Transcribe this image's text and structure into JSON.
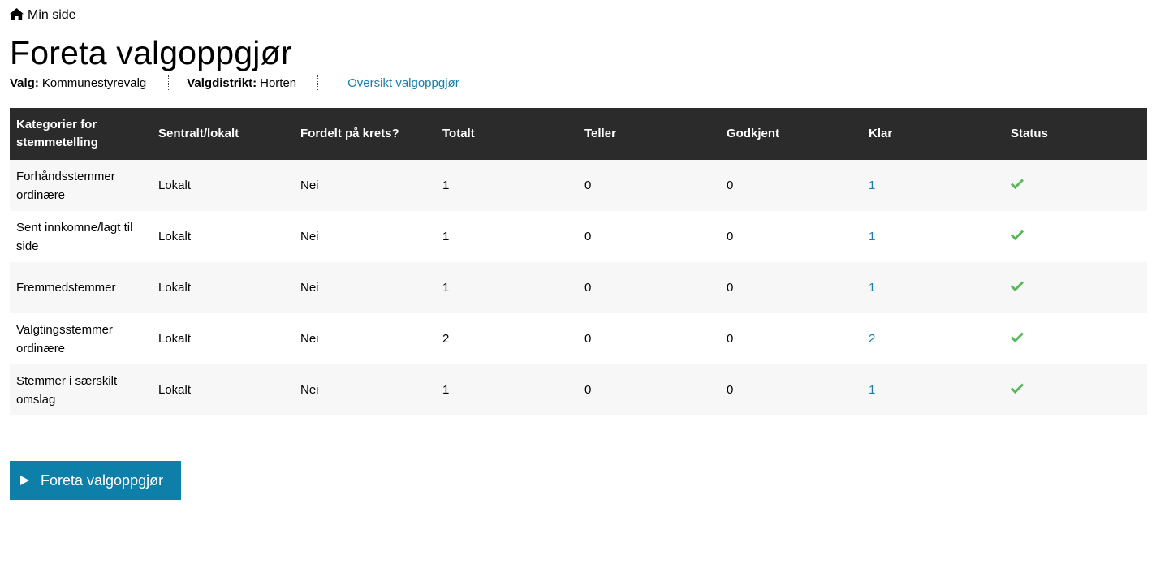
{
  "breadcrumb": {
    "home_label": "Min side"
  },
  "page": {
    "title": "Foreta valgoppgjør"
  },
  "meta": {
    "valg_label": "Valg:",
    "valg_value": "Kommunestyrevalg",
    "distrikt_label": "Valgdistrikt:",
    "distrikt_value": "Horten",
    "overview_link": "Oversikt valgoppgjør"
  },
  "table": {
    "headers": [
      "Kategorier for stemmetelling",
      "Sentralt/lokalt",
      "Fordelt på krets?",
      "Totalt",
      "Teller",
      "Godkjent",
      "Klar",
      "Status"
    ],
    "rows": [
      {
        "category": "Forhåndsstemmer ordinære",
        "location": "Lokalt",
        "by_district": "Nei",
        "total": "1",
        "counting": "0",
        "approved": "0",
        "ready": "1",
        "status": "ok"
      },
      {
        "category": "Sent innkomne/lagt til side",
        "location": "Lokalt",
        "by_district": "Nei",
        "total": "1",
        "counting": "0",
        "approved": "0",
        "ready": "1",
        "status": "ok"
      },
      {
        "category": "Fremmedstemmer",
        "location": "Lokalt",
        "by_district": "Nei",
        "total": "1",
        "counting": "0",
        "approved": "0",
        "ready": "1",
        "status": "ok"
      },
      {
        "category": "Valgtingsstemmer ordinære",
        "location": "Lokalt",
        "by_district": "Nei",
        "total": "2",
        "counting": "0",
        "approved": "0",
        "ready": "2",
        "status": "ok"
      },
      {
        "category": "Stemmer i særskilt omslag",
        "location": "Lokalt",
        "by_district": "Nei",
        "total": "1",
        "counting": "0",
        "approved": "0",
        "ready": "1",
        "status": "ok"
      }
    ]
  },
  "action": {
    "button_label": "Foreta valgoppgjør"
  },
  "icons": {
    "home": "home-icon",
    "status": "check-icon",
    "button": "play-icon"
  },
  "colors": {
    "link": "#1a7fa8",
    "header_bg": "#2b2b2b",
    "button_bg": "#0d7fa8",
    "check": "#5cb85c"
  }
}
